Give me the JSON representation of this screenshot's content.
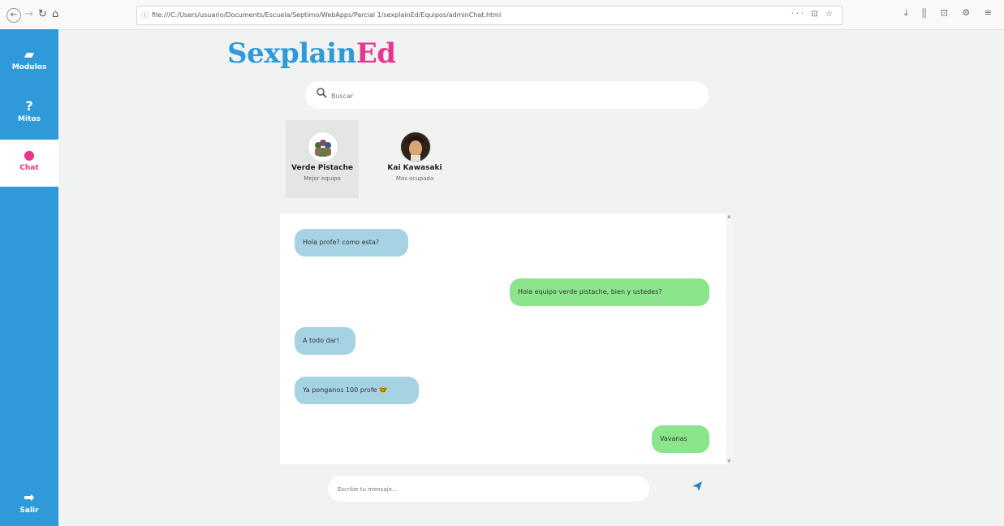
{
  "browser": {
    "url": "file:///C:/Users/usuario/Documents/Escuela/Septimo/WebApps/Parcial 1/sexplainEd/Equipos/adminChat.html",
    "info_icon": "info-icon",
    "nav": {
      "back": "←",
      "forward": "→",
      "reload": "↻",
      "home": "⌂"
    },
    "url_actions": "··· ⊡ ☆",
    "toolbar_icons": "⤓ ⫼ ⊡ ⚙ ≡"
  },
  "sidebar": {
    "items": [
      {
        "label": "Modulos",
        "icon": "book-icon",
        "glyph": "▰"
      },
      {
        "label": "Mitos",
        "icon": "question-icon",
        "glyph": "?"
      },
      {
        "label": "Chat",
        "icon": "chat-bubble-icon",
        "glyph": "●",
        "active": true
      },
      {
        "label": "Salir",
        "icon": "logout-icon",
        "glyph": "➡"
      }
    ]
  },
  "logo": {
    "part1": "Sexplain",
    "part2": "Ed",
    "colors": {
      "blue": "#2f9ad9",
      "pink": "#e6378d"
    }
  },
  "search": {
    "placeholder": "Buscar"
  },
  "contacts": [
    {
      "name": "Verde Pistache",
      "subtitle": "Mejor equipo",
      "selected": true
    },
    {
      "name": "Kai Kawasaki",
      "subtitle": "Mas ocupada"
    }
  ],
  "messages": [
    {
      "text": "Hola profe? como esta?",
      "direction": "in"
    },
    {
      "text": "Hola equipo verde pistache, bien y ustedes?",
      "direction": "out"
    },
    {
      "text": "A todo dar!",
      "direction": "in"
    },
    {
      "text": "Ya ponganos 100 profe 🤓",
      "direction": "in"
    },
    {
      "text": "Vavanas",
      "direction": "out"
    }
  ],
  "compose": {
    "placeholder": "Escribe tu mensaje..."
  },
  "colors": {
    "sidebar": "#2f9ad9",
    "incoming": "#a6d3e3",
    "outgoing": "#8ae58c",
    "active_chat": "#e6378d"
  }
}
